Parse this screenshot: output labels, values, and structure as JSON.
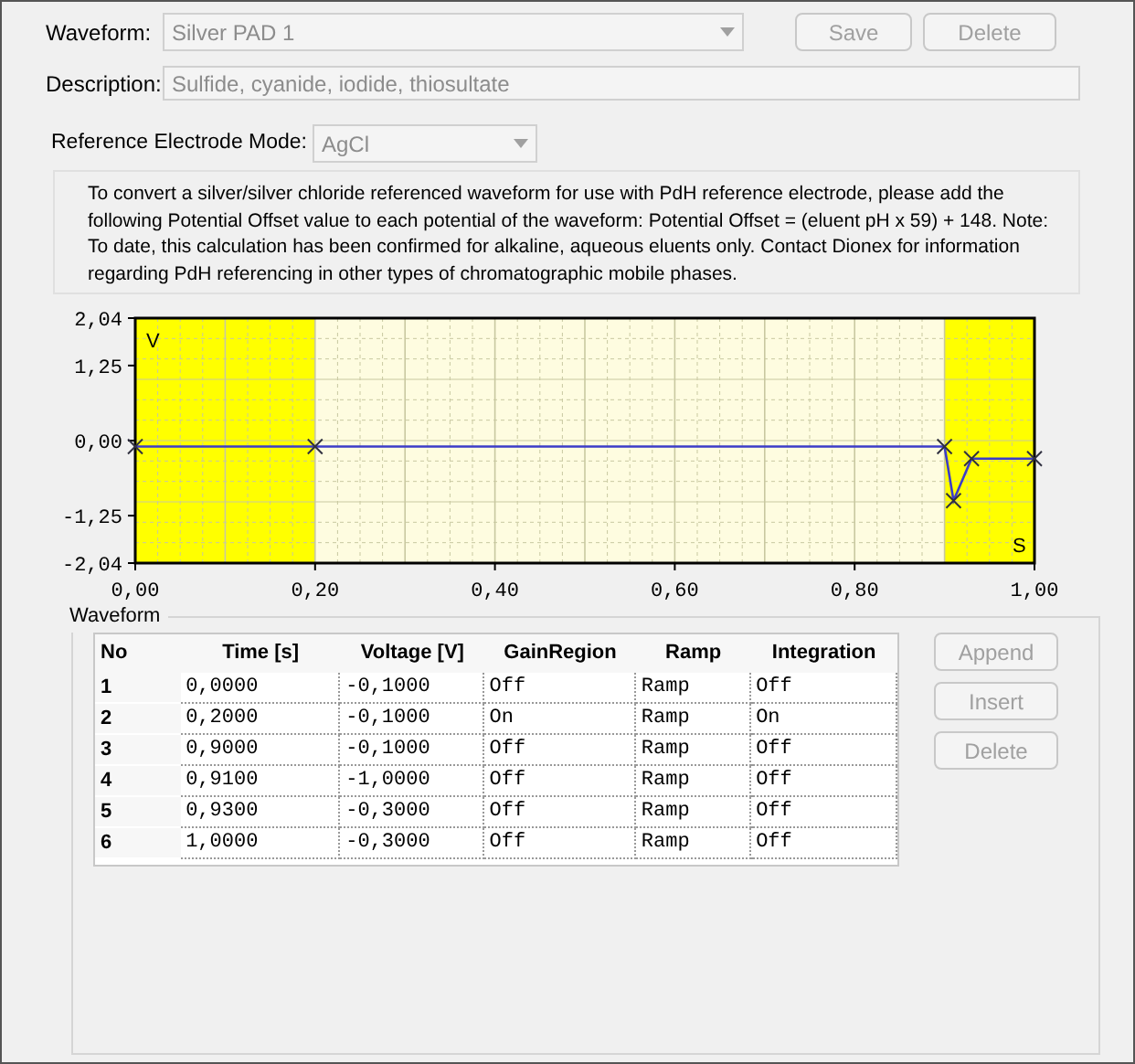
{
  "waveform_field": {
    "label": "Waveform:",
    "value": "Silver PAD 1",
    "disabled": true
  },
  "top_buttons": [
    {
      "label": "Save",
      "disabled": true
    },
    {
      "label": "Delete",
      "disabled": true
    }
  ],
  "description_field": {
    "label": "Description:",
    "value": "Sulfide, cyanide, iodide, thiosultate",
    "disabled": true
  },
  "reference_mode": {
    "label": "Reference Electrode Mode:",
    "value": "AgCl",
    "disabled": true
  },
  "info_text": "To convert a silver/silver chloride referenced waveform for use with PdH reference electrode, please add the following Potential Offset value to each potential of the waveform: Potential Offset = (eluent pH  x 59) + 148. Note: To date, this calculation has been confirmed for alkaline, aqueous eluents only. Contact Dionex for information regarding PdH referencing in other types of chromatographic mobile phases.",
  "chart": {
    "chart_data": {
      "type": "line",
      "xlabel": "S",
      "ylabel": "V",
      "x": [
        0,
        0.2,
        0.9,
        0.91,
        0.93,
        1.0
      ],
      "series": [
        {
          "color": "#3c3cc8",
          "marker": "x",
          "values": [
            -0.1,
            -0.1,
            -0.1,
            -1.0,
            -0.3,
            -0.3
          ]
        }
      ],
      "grid": true,
      "xlim": [
        0,
        1
      ],
      "ylim": [
        -2.04,
        2.04
      ],
      "xticks": [
        {
          "value": 0,
          "label": "0,00"
        },
        {
          "value": 0.2,
          "label": "0,20"
        },
        {
          "value": 0.4,
          "label": "0,40"
        },
        {
          "value": 0.6,
          "label": "0,60"
        },
        {
          "value": 0.8,
          "label": "0,80"
        },
        {
          "value": 1,
          "label": "1,00"
        }
      ],
      "yticks": [
        {
          "value": 2.04,
          "label": "2,04"
        },
        {
          "value": 1.25,
          "label": "1,25"
        },
        {
          "value": 0,
          "label": "0,00"
        },
        {
          "value": -1.25,
          "label": "-1,25"
        },
        {
          "value": -2.04,
          "label": "-2,04"
        }
      ],
      "bands": [
        {
          "axis": "x",
          "from": 0.2,
          "to": 0.9
        }
      ]
    }
  },
  "waveform_group": {
    "title": "Waveform",
    "table": {
      "columns": [
        "No",
        "Time [s]",
        "Voltage [V]",
        "GainRegion",
        "Ramp",
        "Integration"
      ],
      "rows": [
        [
          "1",
          "0,0000",
          "-0,1000",
          "Off",
          "Ramp",
          "Off"
        ],
        [
          "2",
          "0,2000",
          "-0,1000",
          "On",
          "Ramp",
          "On"
        ],
        [
          "3",
          "0,9000",
          "-0,1000",
          "Off",
          "Ramp",
          "Off"
        ],
        [
          "4",
          "0,9100",
          "-1,0000",
          "Off",
          "Ramp",
          "Off"
        ],
        [
          "5",
          "0,9300",
          "-0,3000",
          "Off",
          "Ramp",
          "Off"
        ],
        [
          "6",
          "1,0000",
          "-0,3000",
          "Off",
          "Ramp",
          "Off"
        ]
      ]
    },
    "buttons": [
      {
        "label": "Append",
        "disabled": true
      },
      {
        "label": "Insert",
        "disabled": true
      },
      {
        "label": "Delete",
        "disabled": true
      }
    ]
  }
}
